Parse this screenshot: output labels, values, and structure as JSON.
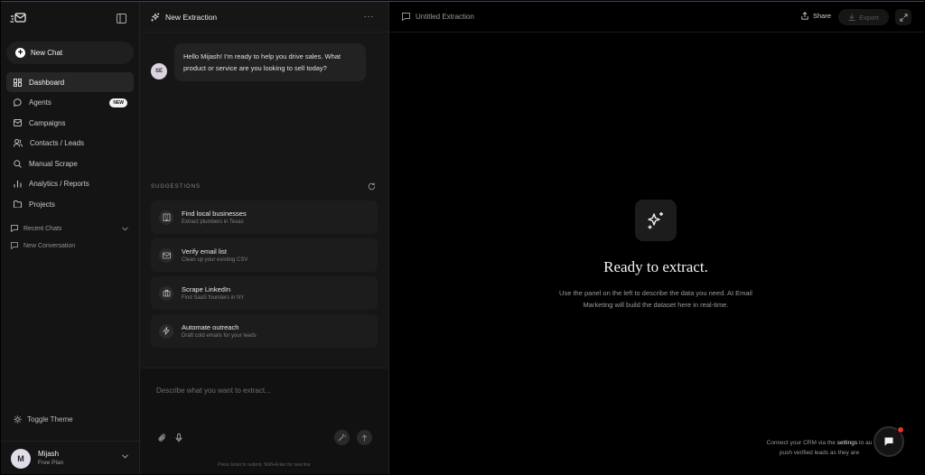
{
  "sidebar": {
    "new_chat": "New Chat",
    "items": [
      {
        "label": "Dashboard",
        "icon": "dashboard-icon",
        "active": true
      },
      {
        "label": "Agents",
        "icon": "chat-bubble-icon",
        "badge": "NEW"
      },
      {
        "label": "Campaigns",
        "icon": "mail-icon"
      },
      {
        "label": "Contacts / Leads",
        "icon": "users-icon"
      },
      {
        "label": "Manual Scrape",
        "icon": "search-icon"
      },
      {
        "label": "Analytics / Reports",
        "icon": "bar-chart-icon"
      },
      {
        "label": "Projects",
        "icon": "folder-icon"
      }
    ],
    "recent_chats_label": "Recent Chats",
    "recent_chats": [
      "New Conversation"
    ],
    "toggle_theme": "Toggle Theme",
    "user": {
      "initial": "M",
      "name": "Mijash",
      "plan": "Free Plan"
    }
  },
  "middle": {
    "title": "New Extraction",
    "message": {
      "avatar": "SE",
      "text": "Hello Mijash! I'm ready to help you drive sales. What product or service are you looking to sell today?"
    },
    "suggestions_label": "SUGGESTIONS",
    "suggestions": [
      {
        "title": "Find local businesses",
        "subtitle": "Extract plumbers in Texas",
        "icon": "building-icon"
      },
      {
        "title": "Verify email list",
        "subtitle": "Clean up your existing CSV",
        "icon": "mail-icon"
      },
      {
        "title": "Scrape LinkedIn",
        "subtitle": "Find SaaS founders in NY",
        "icon": "briefcase-icon"
      },
      {
        "title": "Automate outreach",
        "subtitle": "Draft cold emails for your leads",
        "icon": "lightning-icon"
      }
    ],
    "composer": {
      "placeholder": "Describe what you want to extract...",
      "hint": "Press Enter to submit, Shift+Enter for new line"
    }
  },
  "right": {
    "title": "Untitled Extraction",
    "share": "Share",
    "export": "Export",
    "hero_title": "Ready to extract.",
    "hero_desc": "Use the panel on the left to describe the data you need. AI Email Marketing will build the dataset here in real-time.",
    "crm_prefix": "Connect your CRM via the ",
    "crm_link": "settings",
    "crm_suffix": " to au",
    "crm_line2": "push verified leads as they are"
  },
  "colors": {
    "accent_dot": "#e0362c",
    "background": "#000000",
    "sidebar": "#141414",
    "panel": "#161616"
  }
}
